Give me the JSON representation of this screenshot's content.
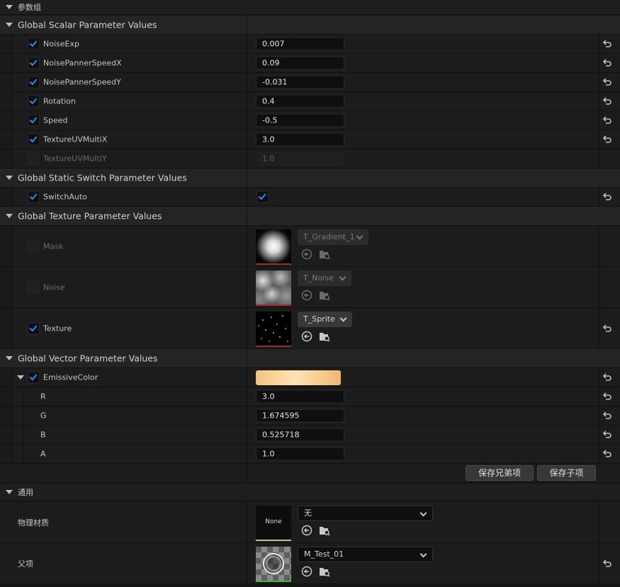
{
  "top_category": {
    "title": "参数组"
  },
  "scalar_group": {
    "title": "Global Scalar Parameter Values",
    "params": [
      {
        "name": "NoiseExp",
        "value": "0.007",
        "enabled": true
      },
      {
        "name": "NoisePannerSpeedX",
        "value": "0.09",
        "enabled": true
      },
      {
        "name": "NoisePannerSpeedY",
        "value": "-0.031",
        "enabled": true
      },
      {
        "name": "Rotation",
        "value": "0.4",
        "enabled": true
      },
      {
        "name": "Speed",
        "value": "-0.5",
        "enabled": true
      },
      {
        "name": "TextureUVMultiX",
        "value": "3.0",
        "enabled": true
      },
      {
        "name": "TextureUVMultiY",
        "value": "1.0",
        "enabled": false
      }
    ]
  },
  "static_switch_group": {
    "title": "Global Static Switch Parameter Values",
    "params": [
      {
        "name": "SwitchAuto",
        "checked": true,
        "enabled": true
      }
    ]
  },
  "texture_group": {
    "title": "Global Texture Parameter Values",
    "params": [
      {
        "name": "Mask",
        "texture": "T_Gradient_1",
        "enabled": false,
        "thumb_icon": "radial-gradient-thumbnail"
      },
      {
        "name": "Noise",
        "texture": "T_Noise",
        "enabled": false,
        "thumb_icon": "noise-thumbnail"
      },
      {
        "name": "Texture",
        "texture": "T_Sprite",
        "enabled": true,
        "thumb_icon": "sprite-thumbnail"
      }
    ]
  },
  "vector_group": {
    "title": "Global Vector Parameter Values",
    "param": {
      "name": "EmissiveColor",
      "enabled": true,
      "components": [
        {
          "name": "R",
          "value": "3.0"
        },
        {
          "name": "G",
          "value": "1.674595"
        },
        {
          "name": "B",
          "value": "0.525718"
        },
        {
          "name": "A",
          "value": "1.0"
        }
      ]
    }
  },
  "buttons": {
    "save_sibling": "保存兄弟项",
    "save_child": "保存子项"
  },
  "general_category": {
    "title": "通用",
    "phys_material": {
      "label": "物理材质",
      "thumb_text": "None",
      "value": "无"
    },
    "parent": {
      "label": "父项",
      "value": "M_Test_01"
    }
  },
  "colors": {
    "accent": "#1f8cff",
    "background": "#151515",
    "row": "#1c1c1c"
  }
}
